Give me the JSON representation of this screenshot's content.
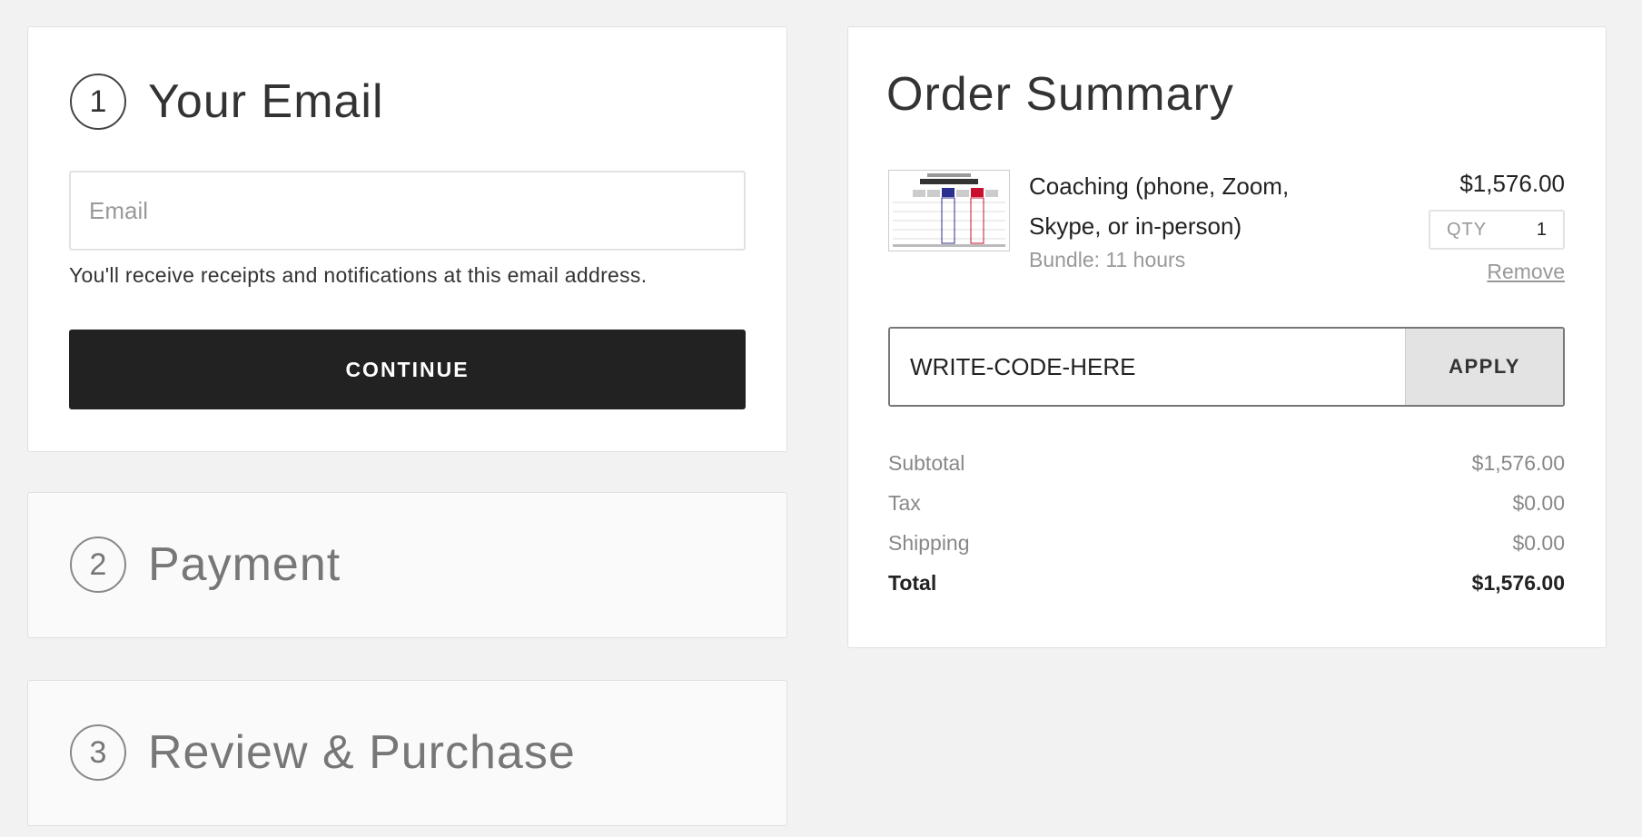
{
  "steps": [
    {
      "number": "1",
      "title": "Your Email"
    },
    {
      "number": "2",
      "title": "Payment"
    },
    {
      "number": "3",
      "title": "Review & Purchase"
    }
  ],
  "email": {
    "placeholder": "Email",
    "note": "You'll receive receipts and notifications at this email address.",
    "continue_label": "CONTINUE"
  },
  "summary": {
    "title": "Order Summary",
    "item": {
      "name": "Coaching (phone, Zoom, Skype, or in-person)",
      "variant": "Bundle: 11 hours",
      "price": "$1,576.00",
      "qty_label": "QTY",
      "qty": "1",
      "remove_label": "Remove",
      "thumbnail_icon": "coaching-bundles-image"
    },
    "coupon": {
      "value": "WRITE-CODE-HERE",
      "apply_label": "APPLY"
    },
    "totals": [
      {
        "label": "Subtotal",
        "value": "$1,576.00"
      },
      {
        "label": "Tax",
        "value": "$0.00"
      },
      {
        "label": "Shipping",
        "value": "$0.00"
      },
      {
        "label": "Total",
        "value": "$1,576.00"
      }
    ]
  },
  "colors": {
    "background": "#f2f2f2",
    "button_dark": "#222222",
    "apply_bg": "#e3e3e3"
  }
}
